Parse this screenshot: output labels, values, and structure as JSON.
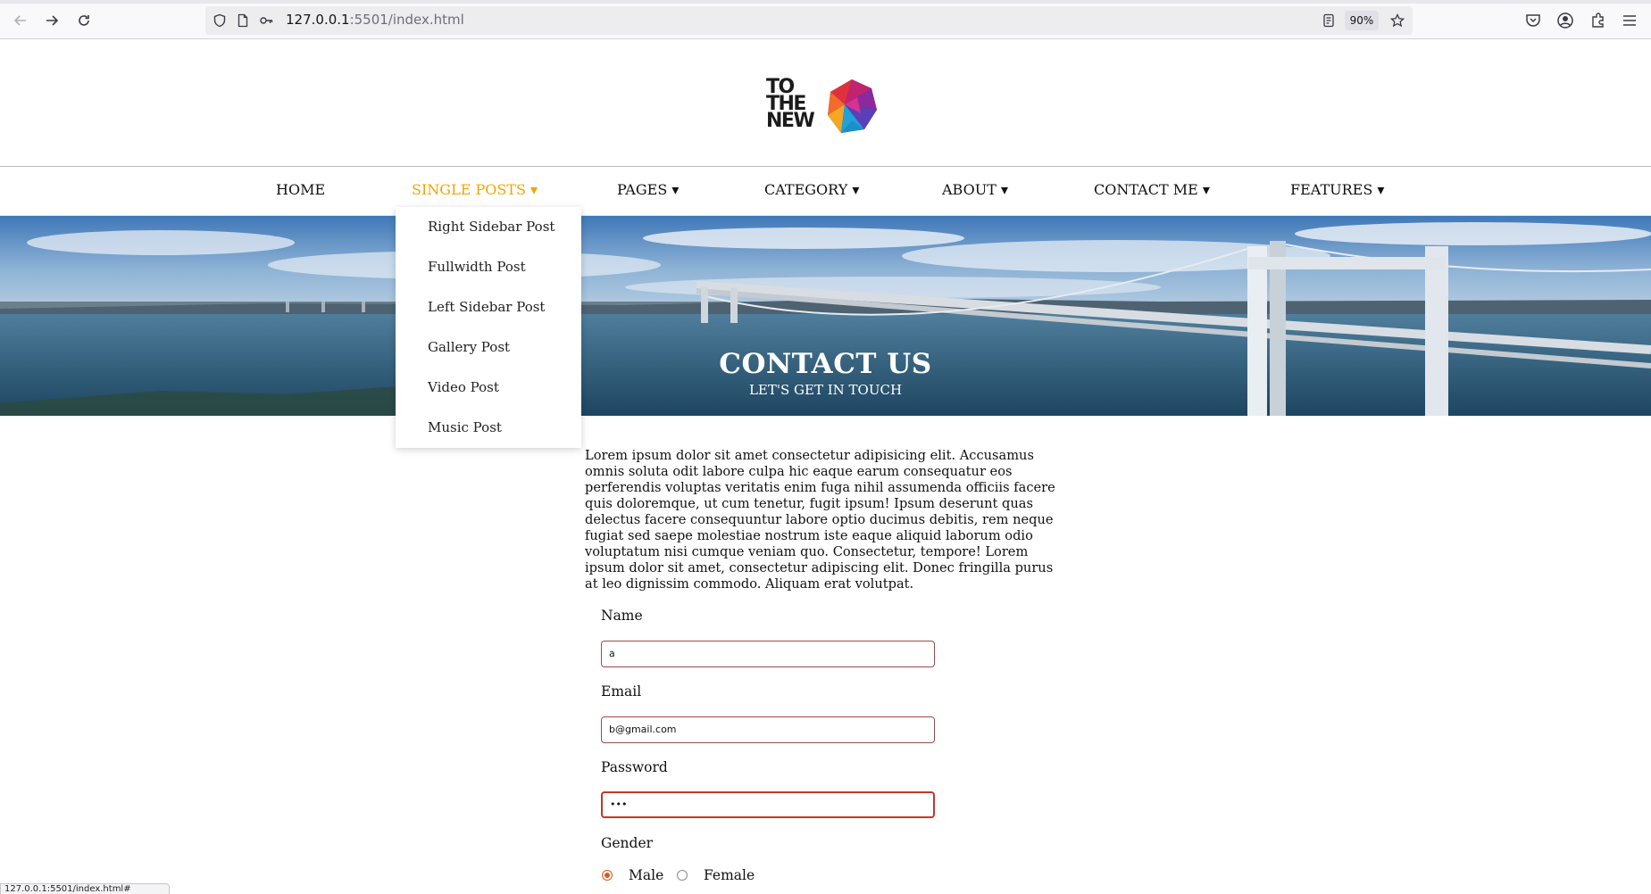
{
  "browser": {
    "url_host": "127.0.0.1",
    "url_rest": ":5501/index.html",
    "zoom": "90%",
    "status_url": "127.0.0.1:5501/index.html#"
  },
  "logo": {
    "line1": "TO",
    "line2": "THE",
    "line3": "NEW"
  },
  "nav": {
    "items": [
      {
        "label": "HOME"
      },
      {
        "label": "SINGLE POSTS ▾"
      },
      {
        "label": "PAGES ▾"
      },
      {
        "label": "CATEGORY ▾"
      },
      {
        "label": "ABOUT ▾"
      },
      {
        "label": "CONTACT ME ▾"
      },
      {
        "label": "FEATURES ▾"
      }
    ],
    "active_color": "#f0a500"
  },
  "dropdown": {
    "items": [
      {
        "label": "Right Sidebar Post"
      },
      {
        "label": "Fullwidth Post"
      },
      {
        "label": "Left Sidebar Post"
      },
      {
        "label": "Gallery Post"
      },
      {
        "label": "Video Post"
      },
      {
        "label": "Music Post"
      }
    ]
  },
  "hero": {
    "title": "CONTACT US",
    "subtitle": "LET'S GET IN TOUCH"
  },
  "content": {
    "paragraph": "Lorem ipsum dolor sit amet consectetur adipisicing elit. Accusamus omnis soluta odit labore culpa hic eaque earum consequatur eos perferendis voluptas veritatis enim fuga nihil assumenda officiis facere quis doloremque, ut cum tenetur, fugit ipsum! Ipsum deserunt quas delectus facere consequuntur labore optio ducimus debitis, rem neque fugiat sed saepe molestiae nostrum iste eaque aliquid laborum odio voluptatum nisi cumque veniam quo. Consectetur, tempore! Lorem ipsum dolor sit amet, consectetur adipiscing elit. Donec fringilla purus at leo dignissim commodo. Aliquam erat volutpat."
  },
  "form": {
    "name_label": "Name",
    "name_value": "a",
    "email_label": "Email",
    "email_value": "b@gmail.com",
    "password_label": "Password",
    "password_value": "•••",
    "gender_label": "Gender",
    "gender_male": "Male",
    "gender_female": "Female",
    "selected_gender": "Male"
  }
}
